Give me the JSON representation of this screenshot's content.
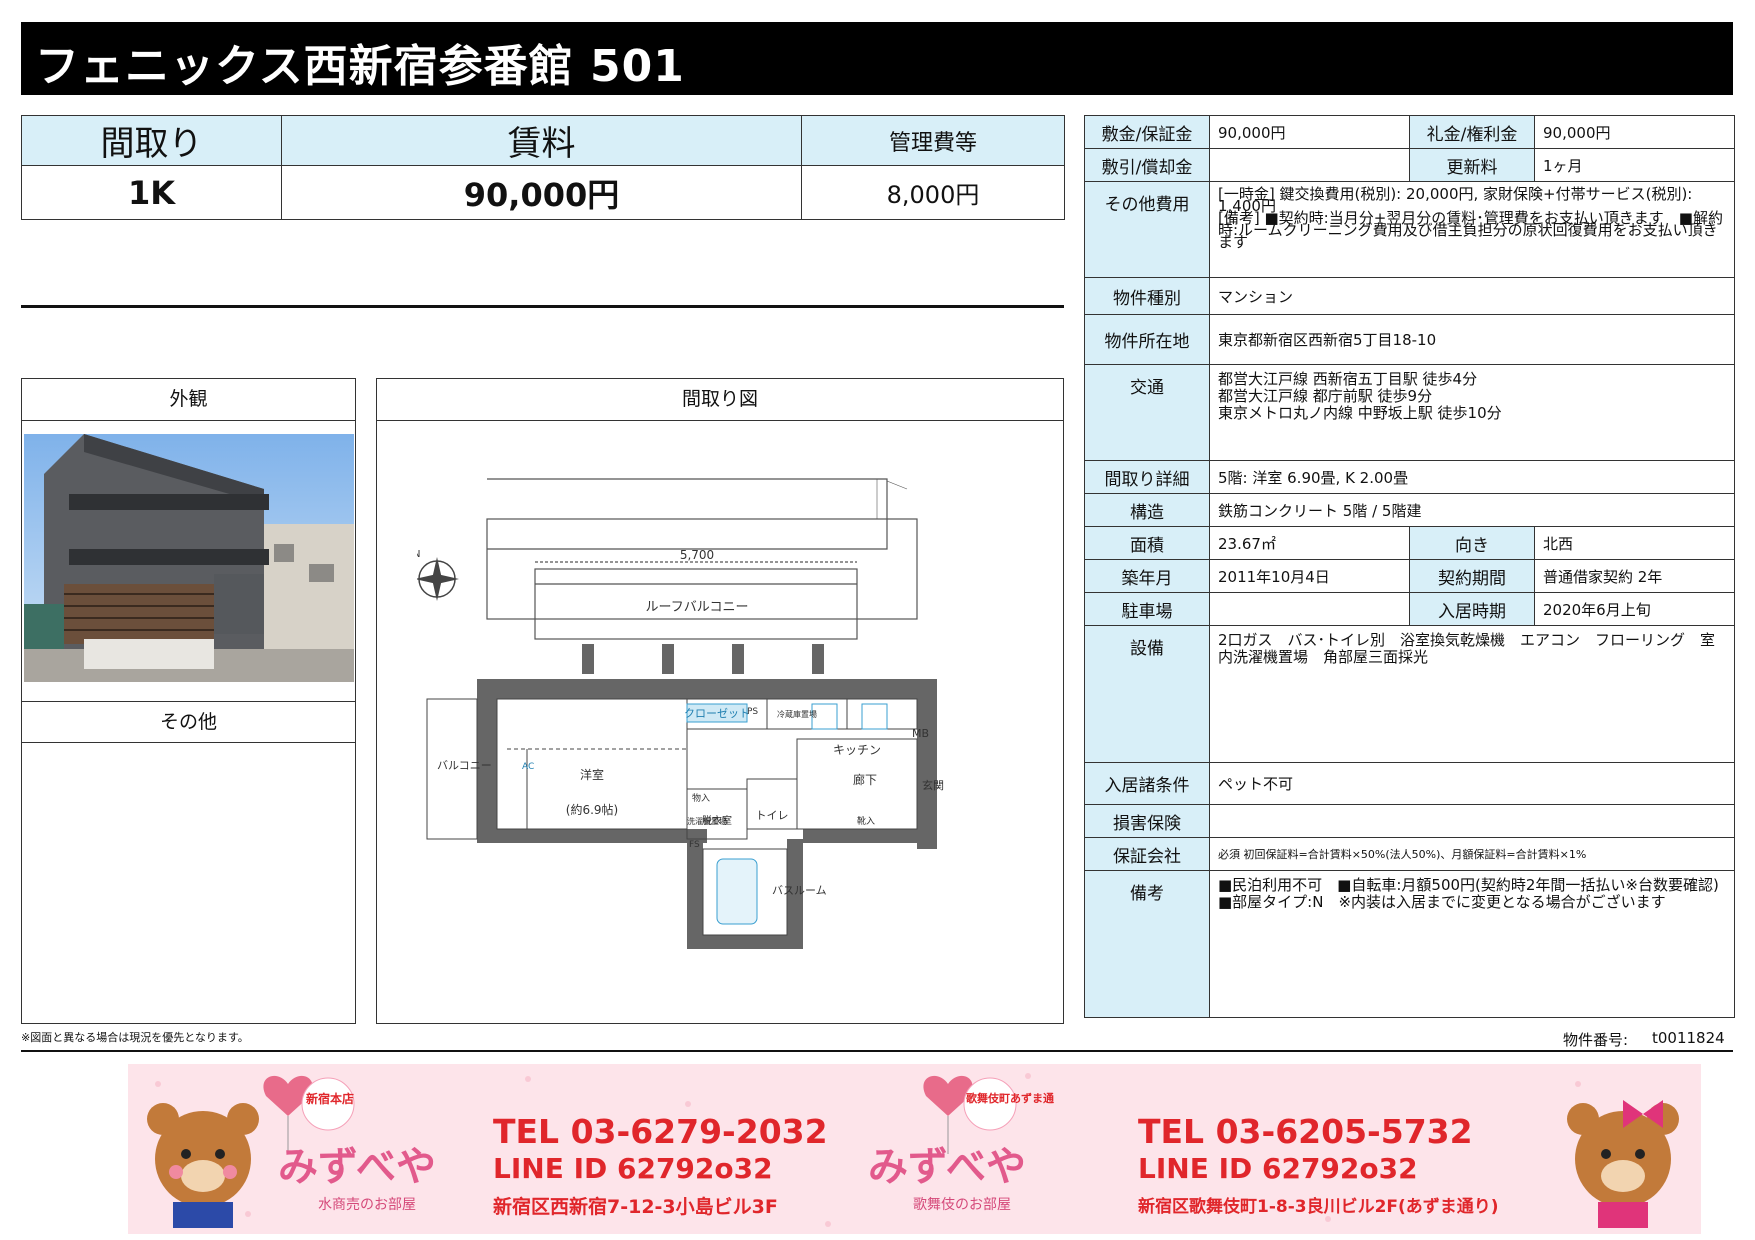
{
  "title": "フェニックス西新宿参番館 501",
  "summary": {
    "layout_label": "間取り",
    "rent_label": "賃料",
    "management_label": "管理費等",
    "layout": "1K",
    "rent": "90,000円",
    "management_fee": "8,000円"
  },
  "panels": {
    "exterior_label": "外観",
    "other_label": "その他",
    "floor_plan_label": "間取り図"
  },
  "floor_plan_labels": {
    "width_dim": "5,700",
    "roof_balcony": "ルーフバルコニー",
    "closet": "クローゼット",
    "western_room": "洋室",
    "western_room_size": "(約6.9帖)",
    "kitchen": "キッチン",
    "hallway": "廊下",
    "entrance": "玄関",
    "toilet": "トイレ",
    "bath": "バスルーム",
    "dressing": "脱衣室",
    "balcony": "バルコニー",
    "mb": "MB",
    "ps": "PS",
    "fs": "FS",
    "ac": "AC",
    "storage": "物入",
    "shoebox": "靴入",
    "laundry": "洗濯機置場",
    "refrigerator": "冷蔵庫置場",
    "north": "N"
  },
  "details": {
    "deposit_label": "敷金/保証金",
    "deposit": "90,000円",
    "key_money_label": "礼金/権利金",
    "key_money": "90,000円",
    "amortization_label": "敷引/償却金",
    "amortization": "",
    "renewal_label": "更新料",
    "renewal": "1ヶ月",
    "other_costs_label": "その他費用",
    "other_costs": "[一時金] 鍵交換費用(税別): 20,000円, 家財保険+付帯サービス(税別): 1,400円\n[備考] ■契約時:当月分+翌月分の賃料･管理費をお支払い頂きます　■解約時:ルームクリーニング費用及び借主負担分の原状回復費用をお支払い頂きます",
    "type_label": "物件種別",
    "type": "マンション",
    "address_label": "物件所在地",
    "address": "東京都新宿区西新宿5丁目18-10",
    "access_label": "交通",
    "access": [
      "都営大江戸線 西新宿五丁目駅 徒歩4分",
      "都営大江戸線 都庁前駅 徒歩9分",
      "東京メトロ丸ノ内線 中野坂上駅 徒歩10分"
    ],
    "layout_detail_label": "間取り詳細",
    "layout_detail": "5階: 洋室 6.90畳, K 2.00畳",
    "structure_label": "構造",
    "structure": "鉄筋コンクリート 5階 / 5階建",
    "area_label": "面積",
    "area": "23.67㎡",
    "direction_label": "向き",
    "direction": "北西",
    "built_label": "築年月",
    "built": "2011年10月4日",
    "contract_label": "契約期間",
    "contract": "普通借家契約 2年",
    "parking_label": "駐車場",
    "parking": "",
    "move_in_label": "入居時期",
    "move_in": "2020年6月上旬",
    "facilities_label": "設備",
    "facilities": "2口ガス　バス･トイレ別　浴室換気乾燥機　エアコン　フローリング　室内洗濯機置場　角部屋三面採光",
    "conditions_label": "入居諸条件",
    "conditions": "ペット不可",
    "insurance_label": "損害保険",
    "insurance": "",
    "guarantor_label": "保証会社",
    "guarantor": "必須 初回保証料=合計賃料×50%(法人50%)、月額保証料=合計賃料×1%",
    "remarks_label": "備考",
    "remarks": "■民泊利用不可　■自転車:月額500円(契約時2年間一括払い※台数要確認)　■部屋タイプ:N　※内装は入居までに変更となる場合がございます"
  },
  "footer": {
    "note": "※図面と異なる場合は現況を優先となります。",
    "property_number_label": "物件番号:",
    "property_number": "t0011824"
  },
  "banner": {
    "shop1_badge": "新宿本店",
    "shop1_name": "みずべや",
    "shop1_sub": "水商売のお部屋",
    "shop1_tel": "TEL 03-6279-2032",
    "shop1_line": "LINE ID 62792o32",
    "shop1_address": "新宿区西新宿7-12-3小島ビル3F",
    "shop2_badge": "歌舞伎町あずま通",
    "shop2_name": "みずべや",
    "shop2_sub": "歌舞伎のお部屋",
    "shop2_tel": "TEL 03-6205-5732",
    "shop2_line": "LINE ID 62792o32",
    "shop2_address": "新宿区歌舞伎町1-8-3良川ビル2F(あずま通り)",
    "colors": {
      "red": "#e0262b",
      "pink_bg": "#fde4ea",
      "bear": "#c27a3a"
    }
  }
}
